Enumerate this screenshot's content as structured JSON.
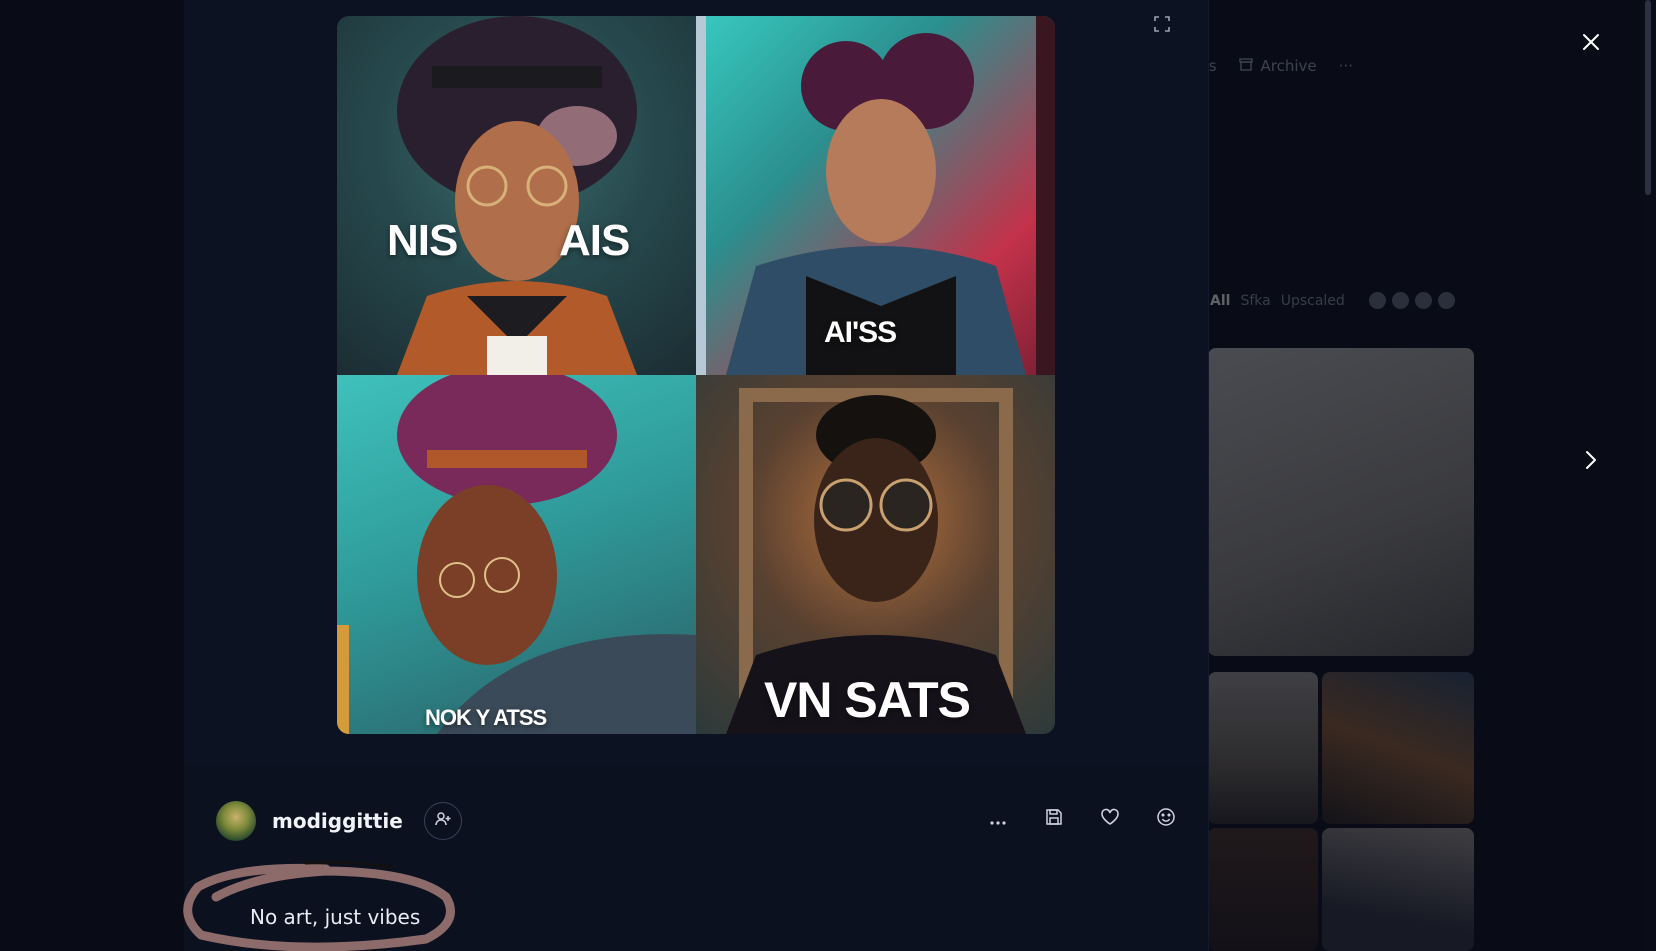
{
  "background": {
    "nav_items": [
      {
        "label": "obs",
        "icon": "none"
      },
      {
        "label": "Archive",
        "icon": "archive-icon"
      },
      {
        "label": "···",
        "icon": "more-icon"
      }
    ],
    "filters": {
      "active": "All",
      "options": [
        "Sfka",
        "Upscaled"
      ]
    }
  },
  "post": {
    "images": [
      {
        "poster_text": "N\nNIS     AIS"
      },
      {
        "poster_text": "AI'SS"
      },
      {
        "poster_text": "NOK Y ATSS"
      },
      {
        "poster_text": "VN SATS"
      }
    ],
    "author": {
      "username": "modiggittie"
    },
    "caption": "No art, just vibes"
  },
  "icons": {
    "expand": "expand-icon",
    "follow": "follow-user-icon",
    "more": "more-horizontal-icon",
    "save": "save-icon",
    "like": "heart-icon",
    "react": "smiley-icon",
    "close": "close-icon",
    "next": "chevron-right-icon"
  },
  "colors": {
    "modal_bg": "#0c1120",
    "page_bg": "#090c16",
    "scribble": "#8c6b6a"
  }
}
